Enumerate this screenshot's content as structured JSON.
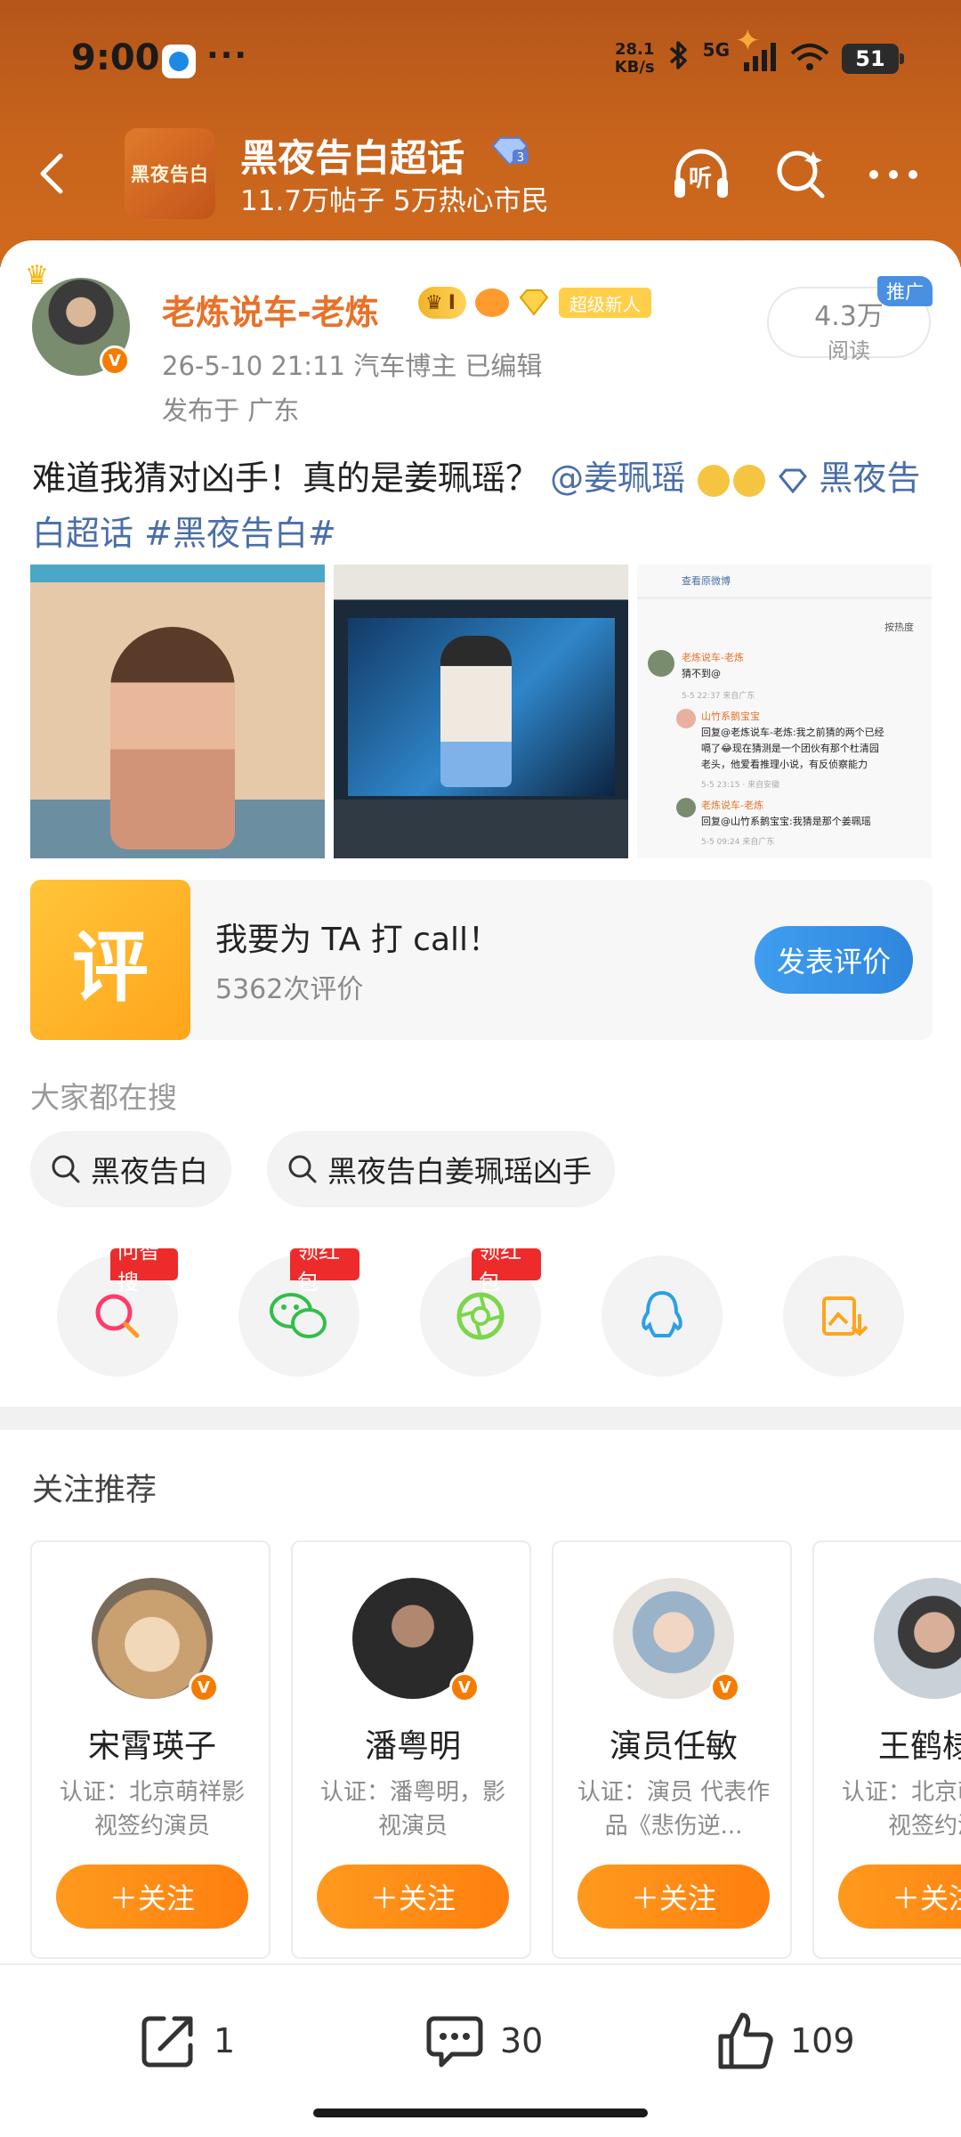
{
  "status_bar": {
    "time": "9:00",
    "more": "···",
    "net_speed_value": "28.1",
    "net_speed_unit": "KB/s",
    "network": "5G",
    "battery": "51"
  },
  "topic": {
    "logo_text": "黑夜告白",
    "title": "黑夜告白超话",
    "stats": "11.7万帖子 5万热心市民",
    "listen_label": "听"
  },
  "post": {
    "author": "老炼说车-老炼",
    "level": "I",
    "super_new_badge": "超级新人",
    "meta": "26-5-10 21:11   汽车博主   已编辑",
    "location": "发布于 广东",
    "read_count": "4.3万",
    "read_label": "阅读",
    "promo_tag": "推广",
    "text_prefix": "难道我猜对凶手！真的是姜珮瑶？",
    "mention": "@姜珮瑶",
    "topic_link": "黑夜告白超话",
    "hashtag": "#黑夜告白#",
    "screenshot": {
      "header": "查看原微博",
      "sort": "按热度",
      "c1_user": "老炼说车-老炼",
      "c1_text": "猜不到@",
      "c1_meta": "5-5 22:37 来自广东",
      "c2_user": "山竹系鹅宝宝",
      "c2_text_1": "回复@老炼说车-老炼:我之前猜的两个已经",
      "c2_text_2": "嗝了😂现在猜测是一个团伙有那个杜清园",
      "c2_text_3": "老头，他爱看推理小说，有反侦察能力",
      "c2_meta": "5-5 23:15 · 来自安徽",
      "c3_user": "老炼说车-老炼",
      "c3_text": "回复@山竹系鹅宝宝:我猜是那个姜珮瑶",
      "c3_meta": "5-5 09:24 来自广东"
    }
  },
  "rating": {
    "icon_char": "评",
    "title": "我要为 TA 打 call！",
    "count": "5362次评价",
    "button": "发表评价"
  },
  "search": {
    "label": "大家都在搜",
    "chips": [
      "黑夜告白",
      "黑夜告白姜珮瑶凶手"
    ]
  },
  "share": {
    "tags": [
      "问智搜",
      "领红包",
      "领红包"
    ]
  },
  "recommend": {
    "title": "关注推荐",
    "follow_label": "关注",
    "users": [
      {
        "name": "宋霄瑛子",
        "desc": "认证：北京萌祥影视签约演员"
      },
      {
        "name": "潘粤明",
        "desc": "认证：潘粤明，影视演员"
      },
      {
        "name": "演员任敏",
        "desc": "认证：演员 代表作品《悲伤逆..."
      },
      {
        "name": "王鹤棣_",
        "desc": "认证：北京萌祥影视签约演"
      }
    ]
  },
  "actions": {
    "repost": "1",
    "comment": "30",
    "like": "109"
  },
  "colors": {
    "accent_orange": "#e8712a",
    "link_blue": "#4a6ea8",
    "follow_orange": "#ff8a14"
  }
}
